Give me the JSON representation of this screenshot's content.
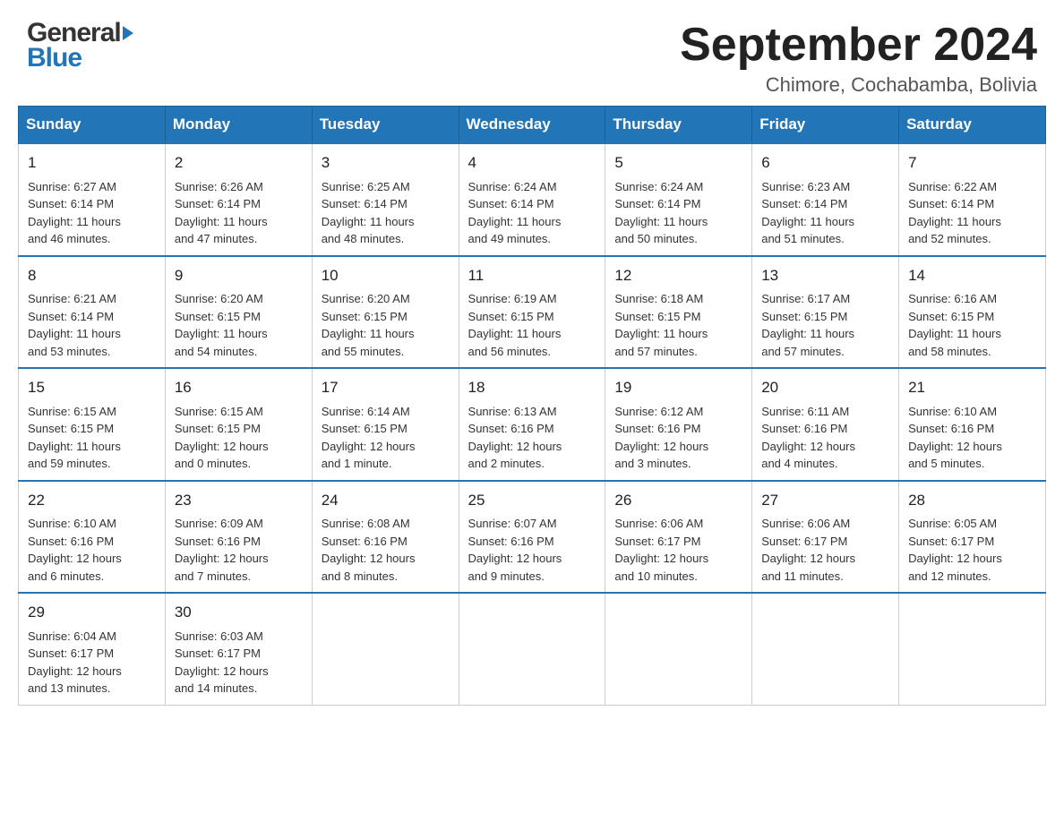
{
  "header": {
    "logo_general": "General",
    "logo_blue": "Blue",
    "month_year": "September 2024",
    "location": "Chimore, Cochabamba, Bolivia"
  },
  "days_of_week": [
    "Sunday",
    "Monday",
    "Tuesday",
    "Wednesday",
    "Thursday",
    "Friday",
    "Saturday"
  ],
  "weeks": [
    [
      {
        "day": "1",
        "sunrise": "6:27 AM",
        "sunset": "6:14 PM",
        "daylight": "11 hours and 46 minutes."
      },
      {
        "day": "2",
        "sunrise": "6:26 AM",
        "sunset": "6:14 PM",
        "daylight": "11 hours and 47 minutes."
      },
      {
        "day": "3",
        "sunrise": "6:25 AM",
        "sunset": "6:14 PM",
        "daylight": "11 hours and 48 minutes."
      },
      {
        "day": "4",
        "sunrise": "6:24 AM",
        "sunset": "6:14 PM",
        "daylight": "11 hours and 49 minutes."
      },
      {
        "day": "5",
        "sunrise": "6:24 AM",
        "sunset": "6:14 PM",
        "daylight": "11 hours and 50 minutes."
      },
      {
        "day": "6",
        "sunrise": "6:23 AM",
        "sunset": "6:14 PM",
        "daylight": "11 hours and 51 minutes."
      },
      {
        "day": "7",
        "sunrise": "6:22 AM",
        "sunset": "6:14 PM",
        "daylight": "11 hours and 52 minutes."
      }
    ],
    [
      {
        "day": "8",
        "sunrise": "6:21 AM",
        "sunset": "6:14 PM",
        "daylight": "11 hours and 53 minutes."
      },
      {
        "day": "9",
        "sunrise": "6:20 AM",
        "sunset": "6:15 PM",
        "daylight": "11 hours and 54 minutes."
      },
      {
        "day": "10",
        "sunrise": "6:20 AM",
        "sunset": "6:15 PM",
        "daylight": "11 hours and 55 minutes."
      },
      {
        "day": "11",
        "sunrise": "6:19 AM",
        "sunset": "6:15 PM",
        "daylight": "11 hours and 56 minutes."
      },
      {
        "day": "12",
        "sunrise": "6:18 AM",
        "sunset": "6:15 PM",
        "daylight": "11 hours and 57 minutes."
      },
      {
        "day": "13",
        "sunrise": "6:17 AM",
        "sunset": "6:15 PM",
        "daylight": "11 hours and 57 minutes."
      },
      {
        "day": "14",
        "sunrise": "6:16 AM",
        "sunset": "6:15 PM",
        "daylight": "11 hours and 58 minutes."
      }
    ],
    [
      {
        "day": "15",
        "sunrise": "6:15 AM",
        "sunset": "6:15 PM",
        "daylight": "11 hours and 59 minutes."
      },
      {
        "day": "16",
        "sunrise": "6:15 AM",
        "sunset": "6:15 PM",
        "daylight": "12 hours and 0 minutes."
      },
      {
        "day": "17",
        "sunrise": "6:14 AM",
        "sunset": "6:15 PM",
        "daylight": "12 hours and 1 minute."
      },
      {
        "day": "18",
        "sunrise": "6:13 AM",
        "sunset": "6:16 PM",
        "daylight": "12 hours and 2 minutes."
      },
      {
        "day": "19",
        "sunrise": "6:12 AM",
        "sunset": "6:16 PM",
        "daylight": "12 hours and 3 minutes."
      },
      {
        "day": "20",
        "sunrise": "6:11 AM",
        "sunset": "6:16 PM",
        "daylight": "12 hours and 4 minutes."
      },
      {
        "day": "21",
        "sunrise": "6:10 AM",
        "sunset": "6:16 PM",
        "daylight": "12 hours and 5 minutes."
      }
    ],
    [
      {
        "day": "22",
        "sunrise": "6:10 AM",
        "sunset": "6:16 PM",
        "daylight": "12 hours and 6 minutes."
      },
      {
        "day": "23",
        "sunrise": "6:09 AM",
        "sunset": "6:16 PM",
        "daylight": "12 hours and 7 minutes."
      },
      {
        "day": "24",
        "sunrise": "6:08 AM",
        "sunset": "6:16 PM",
        "daylight": "12 hours and 8 minutes."
      },
      {
        "day": "25",
        "sunrise": "6:07 AM",
        "sunset": "6:16 PM",
        "daylight": "12 hours and 9 minutes."
      },
      {
        "day": "26",
        "sunrise": "6:06 AM",
        "sunset": "6:17 PM",
        "daylight": "12 hours and 10 minutes."
      },
      {
        "day": "27",
        "sunrise": "6:06 AM",
        "sunset": "6:17 PM",
        "daylight": "12 hours and 11 minutes."
      },
      {
        "day": "28",
        "sunrise": "6:05 AM",
        "sunset": "6:17 PM",
        "daylight": "12 hours and 12 minutes."
      }
    ],
    [
      {
        "day": "29",
        "sunrise": "6:04 AM",
        "sunset": "6:17 PM",
        "daylight": "12 hours and 13 minutes."
      },
      {
        "day": "30",
        "sunrise": "6:03 AM",
        "sunset": "6:17 PM",
        "daylight": "12 hours and 14 minutes."
      },
      null,
      null,
      null,
      null,
      null
    ]
  ],
  "labels": {
    "sunrise": "Sunrise:",
    "sunset": "Sunset:",
    "daylight": "Daylight:"
  }
}
